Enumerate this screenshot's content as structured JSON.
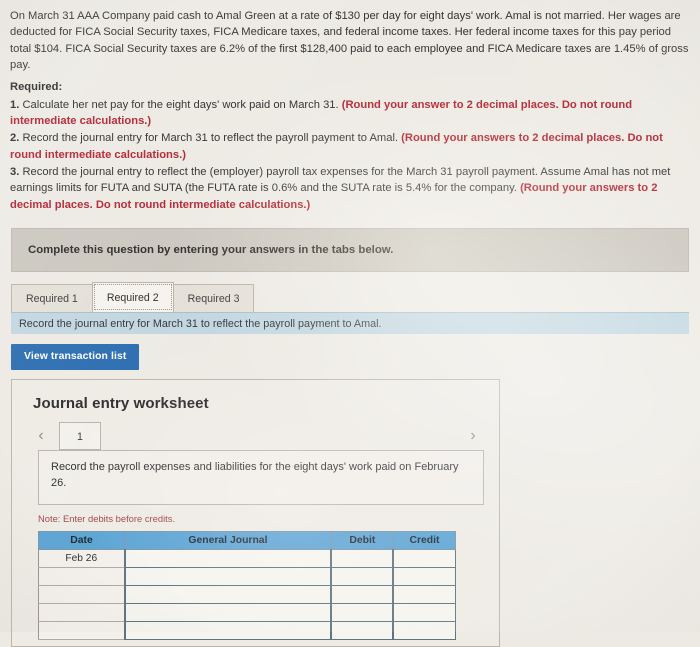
{
  "problem": {
    "statement": "On March 31 AAA Company paid cash to Amal Green at a rate of $130 per day for eight days' work. Amal is not married. Her wages are deducted for FICA Social Security taxes, FICA Medicare taxes, and federal income taxes. Her federal income taxes for this pay period total $104. FICA Social Security taxes are 6.2% of the first $128,400 paid to each employee and FICA Medicare taxes are 1.45% of gross pay."
  },
  "required": {
    "heading": "Required:",
    "items": [
      {
        "num": "1.",
        "text": " Calculate her net pay for the eight days' work paid on March 31. ",
        "emphasis": "(Round your answer to 2 decimal places. Do not round intermediate calculations.)"
      },
      {
        "num": "2.",
        "text": " Record the journal entry for March 31 to reflect the payroll payment to Amal. ",
        "emphasis": "(Round your answers to 2 decimal places. Do not round intermediate calculations.)"
      },
      {
        "num": "3.",
        "text": " Record the journal entry to reflect the (employer) payroll tax expenses for the March 31 payroll payment. Assume Amal has not met earnings limits for FUTA and SUTA (the FUTA rate is 0.6% and the SUTA rate is 5.4% for the company. ",
        "emphasis": "(Round your answers to 2 decimal places. Do not round intermediate calculations.)"
      }
    ]
  },
  "callout": {
    "text": "Complete this question by entering your answers in the tabs below."
  },
  "tabs": [
    {
      "label": "Required 1",
      "active": false
    },
    {
      "label": "Required 2",
      "active": true
    },
    {
      "label": "Required 3",
      "active": false
    }
  ],
  "subbar": {
    "text": "Record the journal entry for March 31 to reflect the payroll payment to Amal."
  },
  "buttons": {
    "view_transaction_list": "View transaction list"
  },
  "worksheet": {
    "title": "Journal entry worksheet",
    "prev_icon": "chevron-left-icon",
    "next_icon": "chevron-right-icon",
    "page_number": "1",
    "prompt": "Record the payroll expenses and liabilities for the eight days' work paid on February 26.",
    "note": "Note: Enter debits before credits.",
    "table": {
      "columns": [
        "Date",
        "General Journal",
        "Debit",
        "Credit"
      ],
      "rows": [
        {
          "date": "Feb 26",
          "general_journal": "",
          "debit": "",
          "credit": ""
        },
        {
          "date": "",
          "general_journal": "",
          "debit": "",
          "credit": ""
        },
        {
          "date": "",
          "general_journal": "",
          "debit": "",
          "credit": ""
        },
        {
          "date": "",
          "general_journal": "",
          "debit": "",
          "credit": ""
        },
        {
          "date": "",
          "general_journal": "",
          "debit": "",
          "credit": ""
        }
      ]
    }
  },
  "colors": {
    "accent_blue": "#2a6cb0",
    "table_header_blue": "#5ba4d4",
    "subbar_blue": "#c2d6e0",
    "callout_gray": "#cbc7bf",
    "emphasis_red": "#b32232",
    "note_red": "#a0444b",
    "page_background": "#edeae4"
  }
}
